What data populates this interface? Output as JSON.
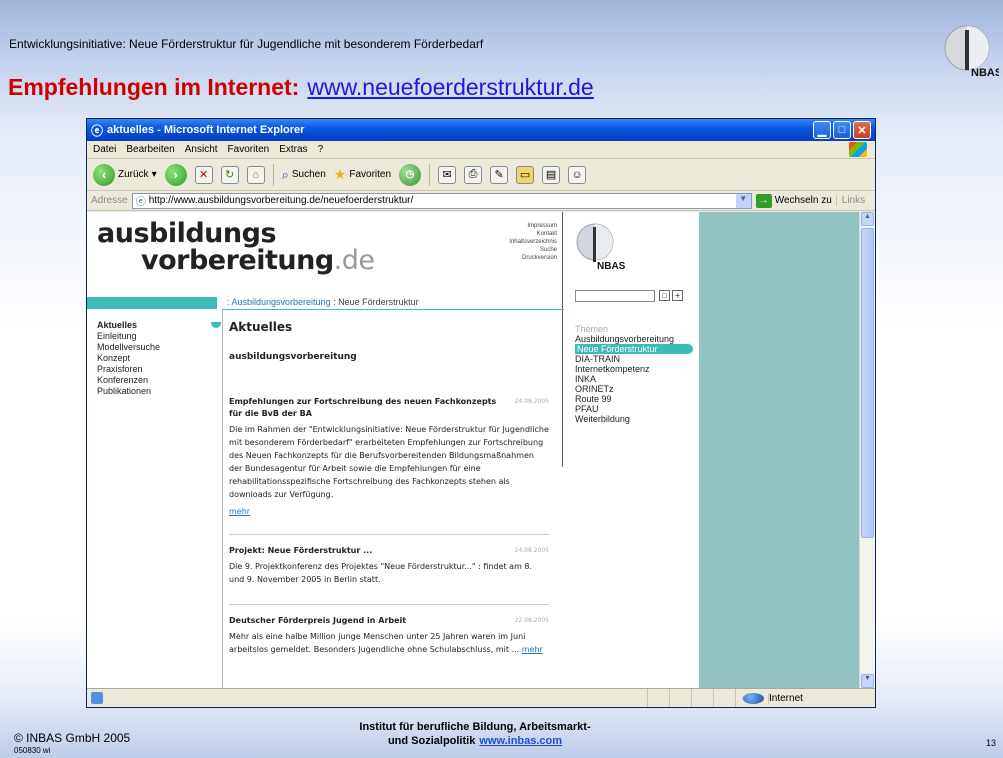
{
  "slide": {
    "subtitle": "Entwicklungsinitiative: Neue Förderstruktur für Jugendliche mit besonderem Förderbedarf",
    "title": "Empfehlungen im Internet:",
    "title_link": "www.neuefoerderstruktur.de",
    "logo_text": "NBAS",
    "footer_copyright": "© INBAS GmbH 2005",
    "footer_code": "050830 wi",
    "footer_institute_line1": "Institut für berufliche Bildung, Arbeitsmarkt-",
    "footer_institute_line2": "und Sozialpolitik",
    "footer_link": "www.inbas.com",
    "page_number": "13"
  },
  "browser": {
    "window_title": "aktuelles - Microsoft Internet Explorer",
    "menu": [
      "Datei",
      "Bearbeiten",
      "Ansicht",
      "Favoriten",
      "Extras",
      "?"
    ],
    "toolbar": {
      "back": "Zurück",
      "search": "Suchen",
      "favorites": "Favoriten"
    },
    "address_label": "Adresse",
    "address_value": "http://www.ausbildungsvorbereitung.de/neuefoerderstruktur/",
    "go_label": "Wechseln zu",
    "links_label": "Links",
    "status_zone": "Internet"
  },
  "site": {
    "logo_line1": "ausbildungs",
    "logo_line2": "vorbereitung",
    "logo_tld": ".de",
    "top_links": [
      "Impressum",
      "Kontakt",
      "Inhaltsverzeichnis",
      "Suche",
      "Druckversion"
    ],
    "breadcrumb_link": ": Ausbildungsvorbereitung",
    "breadcrumb_current": ": Neue Förderstruktur",
    "left_nav": [
      "Aktuelles",
      "Einleitung",
      "Modellversuche",
      "Konzept",
      "Praxisforen",
      "Konferenzen",
      "Publikationen"
    ],
    "heading": "Aktuelles",
    "section": "ausbildungsvorbereitung",
    "news": [
      {
        "title": "Empfehlungen zur Fortschreibung des neuen Fachkonzepts für die BvB der BA",
        "date": "24.08.2005",
        "body": "Die im Rahmen der \"Entwicklungsinitiative: Neue Förderstruktur für Jugendliche mit besonderem Förderbedarf\" erarbeiteten Empfehlungen zur Fortschreibung des Neuen Fachkonzepts für die Berufsvorbereitenden Bildungsmaßnahmen der Bundesagentur für Arbeit sowie die Empfehlungen für eine rehabilitationsspezifische Fortschreibung des Fachkonzepts stehen als downloads zur Verfügung.",
        "more": "mehr"
      },
      {
        "title": "Projekt: Neue Förderstruktur ...",
        "date": "24.08.2005",
        "body": "Die 9. Projektkonferenz des Projektes \"Neue Förderstruktur...\" : findet am 8. und 9. November 2005 in Berlin statt.",
        "more": ""
      },
      {
        "title": "Deutscher Förderpreis Jugend in Arbeit",
        "date": "22.08.2005",
        "body": "Mehr als eine halbe Million junge Menschen unter 25 Jahren waren im Juni arbeitslos gemeldet. Besonders Jugendliche ohne Schulabschluss, mit ...",
        "more": "mehr"
      }
    ],
    "right_logo_text": "NBAS",
    "themes_heading": "Themen",
    "themes": [
      "Ausbildungsvorbereitung",
      "Neue Förderstruktur",
      "DIA-TRAIN",
      "Internetkompetenz",
      "INKA",
      "ORINETz",
      "Route 99",
      "PFAU",
      "Weiterbildung"
    ],
    "themes_active_index": 1
  }
}
